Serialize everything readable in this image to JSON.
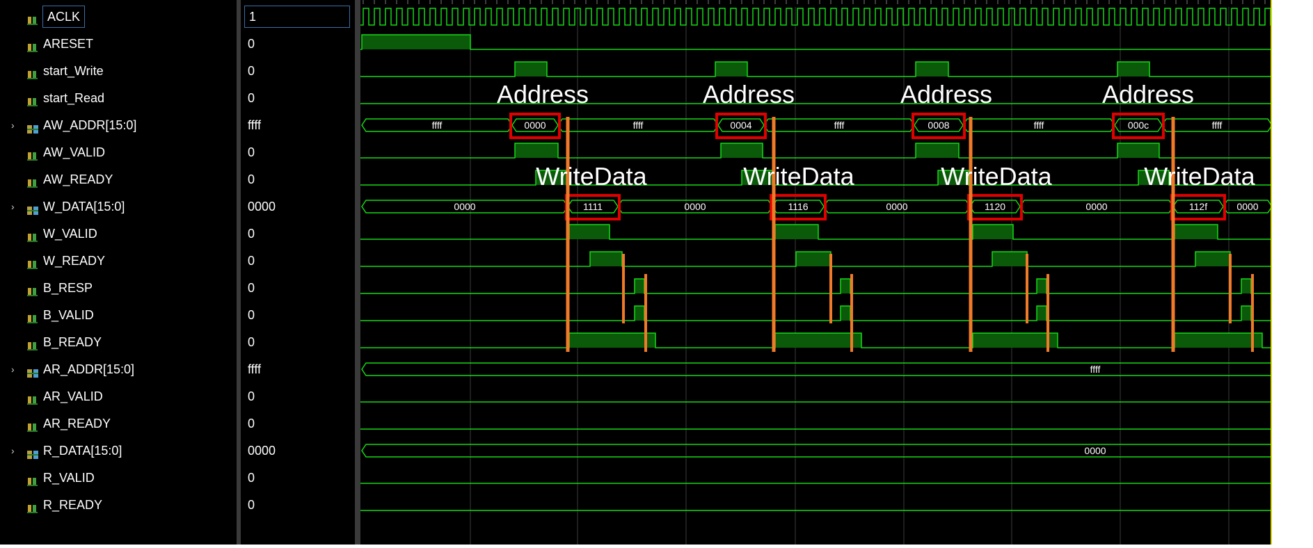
{
  "signals": [
    {
      "name": "ACLK",
      "value": "1",
      "bus": false,
      "selected": true
    },
    {
      "name": "ARESET",
      "value": "0",
      "bus": false
    },
    {
      "name": "start_Write",
      "value": "0",
      "bus": false
    },
    {
      "name": "start_Read",
      "value": "0",
      "bus": false
    },
    {
      "name": "AW_ADDR[15:0]",
      "value": "ffff",
      "bus": true
    },
    {
      "name": "AW_VALID",
      "value": "0",
      "bus": false
    },
    {
      "name": "AW_READY",
      "value": "0",
      "bus": false
    },
    {
      "name": "W_DATA[15:0]",
      "value": "0000",
      "bus": true
    },
    {
      "name": "W_VALID",
      "value": "0",
      "bus": false
    },
    {
      "name": "W_READY",
      "value": "0",
      "bus": false
    },
    {
      "name": "B_RESP",
      "value": "0",
      "bus": false
    },
    {
      "name": "B_VALID",
      "value": "0",
      "bus": false
    },
    {
      "name": "B_READY",
      "value": "0",
      "bus": false
    },
    {
      "name": "AR_ADDR[15:0]",
      "value": "ffff",
      "bus": true
    },
    {
      "name": "AR_VALID",
      "value": "0",
      "bus": false
    },
    {
      "name": "AR_READY",
      "value": "0",
      "bus": false
    },
    {
      "name": "R_DATA[15:0]",
      "value": "0000",
      "bus": true
    },
    {
      "name": "R_VALID",
      "value": "0",
      "bus": false
    },
    {
      "name": "R_READY",
      "value": "0",
      "bus": false
    }
  ],
  "waveforms": {
    "aw_addr": {
      "idle": "ffff",
      "bursts": [
        "0000",
        "0004",
        "0008",
        "000c"
      ]
    },
    "w_data": {
      "idle": "0000",
      "bursts": [
        "1111",
        "1116",
        "1120",
        "112f"
      ]
    },
    "ar_addr": {
      "value": "ffff"
    },
    "r_data": {
      "value": "0000"
    }
  },
  "annotations": {
    "address_label": "Address",
    "writedata_label": "WriteData",
    "labels": [
      {
        "id": "address-1",
        "text": "Address"
      },
      {
        "id": "address-2",
        "text": "Address"
      },
      {
        "id": "address-3",
        "text": "Address"
      },
      {
        "id": "address-4",
        "text": "Address"
      },
      {
        "id": "writedata-1",
        "text": "WriteData"
      },
      {
        "id": "writedata-2",
        "text": "WriteData"
      },
      {
        "id": "writedata-3",
        "text": "WriteData"
      },
      {
        "id": "writedata-4",
        "text": "WriteData"
      }
    ]
  },
  "colors": {
    "background": "#000000",
    "wave": "#16d916",
    "wave_fill": "#0a5a0a",
    "grid": "#3c3c3c",
    "highlight_box": "#e00000",
    "marker": "#f07a28",
    "text": "#ffffff",
    "selection": "#3b6ea8"
  },
  "icons": {
    "single_bit": "signal-bit-icon",
    "bus": "signal-bus-icon",
    "expand": "expand-chevron-icon"
  }
}
